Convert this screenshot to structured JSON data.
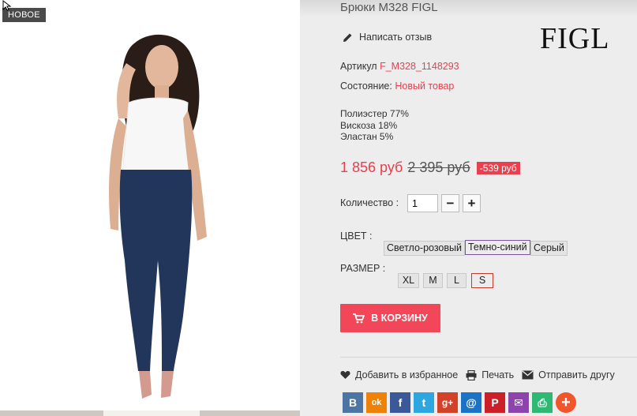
{
  "product": {
    "badge": "НОВОЕ",
    "title": "Брюки M328 FIGL",
    "brand": "FIGL",
    "review_label": "Написать отзыв",
    "sku_label": "Артикул",
    "sku_value": "F_M328_1148293",
    "condition_label": "Состояние:",
    "condition_value": "Новый товар",
    "composition": [
      "Полиэстер 77%",
      "Вискоза 18%",
      "Эластан 5%"
    ],
    "price_current": "1 856 руб",
    "price_old": "2 395 руб",
    "price_discount": "-539 руб"
  },
  "quantity": {
    "label": "Количество :",
    "value": "1",
    "minus": "−",
    "plus": "+"
  },
  "color": {
    "label": "ЦВЕТ :",
    "options": [
      "Светло-розовый",
      "Темно-синий",
      "Серый"
    ],
    "selected": "Темно-синий"
  },
  "size": {
    "label": "РАЗМЕР :",
    "options": [
      "XL",
      "M",
      "L",
      "S"
    ],
    "selected": "S"
  },
  "cart": {
    "label": "В КОРЗИНУ"
  },
  "actions": {
    "wishlist": "Добавить в избранное",
    "print": "Печать",
    "send": "Отправить другу"
  },
  "socials": [
    {
      "name": "vkontakte",
      "glyph": "B",
      "color": "#4c75a3"
    },
    {
      "name": "odnoklassniki",
      "glyph": "ok",
      "color": "#ee8208"
    },
    {
      "name": "facebook",
      "glyph": "f",
      "color": "#3b5998"
    },
    {
      "name": "twitter",
      "glyph": "t",
      "color": "#2ea7e0"
    },
    {
      "name": "google-plus",
      "glyph": "g+",
      "color": "#d24228"
    },
    {
      "name": "mail",
      "glyph": "@",
      "color": "#1a73c7"
    },
    {
      "name": "pinterest",
      "glyph": "P",
      "color": "#cb2027"
    },
    {
      "name": "email",
      "glyph": "✉",
      "color": "#8e44ad"
    },
    {
      "name": "print",
      "glyph": "⎙",
      "color": "#2eb873"
    },
    {
      "name": "more",
      "glyph": "+",
      "color": "#f0552c"
    }
  ],
  "colors": {
    "accent": "#e8404f",
    "cart_button": "#f24758",
    "page_bg": "#ededed"
  }
}
